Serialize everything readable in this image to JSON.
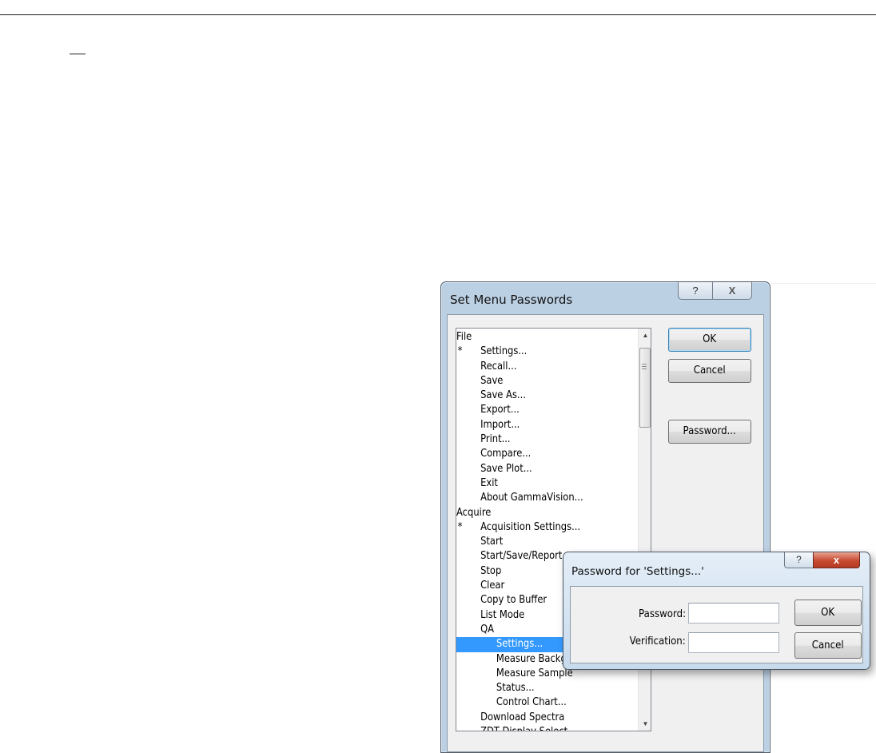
{
  "dialog": {
    "title": "Set Menu Passwords",
    "help_glyph": "?",
    "close_glyph": "X",
    "ok_label": "OK",
    "cancel_label": "Cancel",
    "password_button_label": "Password...",
    "menu_items": [
      {
        "label": "File",
        "level": 0,
        "star": ""
      },
      {
        "label": "Settings...",
        "level": 1,
        "star": "*"
      },
      {
        "label": "Recall...",
        "level": 1,
        "star": ""
      },
      {
        "label": "Save",
        "level": 1,
        "star": ""
      },
      {
        "label": "Save As...",
        "level": 1,
        "star": ""
      },
      {
        "label": "Export...",
        "level": 1,
        "star": ""
      },
      {
        "label": "Import...",
        "level": 1,
        "star": ""
      },
      {
        "label": "Print...",
        "level": 1,
        "star": ""
      },
      {
        "label": "Compare...",
        "level": 1,
        "star": ""
      },
      {
        "label": "Save Plot...",
        "level": 1,
        "star": ""
      },
      {
        "label": "Exit",
        "level": 1,
        "star": ""
      },
      {
        "label": "About GammaVision...",
        "level": 1,
        "star": ""
      },
      {
        "label": "Acquire",
        "level": 0,
        "star": ""
      },
      {
        "label": "Acquisition Settings...",
        "level": 1,
        "star": "*"
      },
      {
        "label": "Start",
        "level": 1,
        "star": ""
      },
      {
        "label": "Start/Save/Report",
        "level": 1,
        "star": ""
      },
      {
        "label": "Stop",
        "level": 1,
        "star": ""
      },
      {
        "label": "Clear",
        "level": 1,
        "star": ""
      },
      {
        "label": "Copy to Buffer",
        "level": 1,
        "star": ""
      },
      {
        "label": "List Mode",
        "level": 1,
        "star": ""
      },
      {
        "label": "QA",
        "level": 1,
        "star": ""
      },
      {
        "label": "Settings...",
        "level": 2,
        "star": "",
        "selected": true
      },
      {
        "label": "Measure Background",
        "level": 2,
        "star": ""
      },
      {
        "label": "Measure Sample",
        "level": 2,
        "star": ""
      },
      {
        "label": "Status...",
        "level": 2,
        "star": ""
      },
      {
        "label": "Control Chart...",
        "level": 2,
        "star": ""
      },
      {
        "label": "Download Spectra",
        "level": 1,
        "star": ""
      },
      {
        "label": "ZDT Display Select",
        "level": 1,
        "star": ""
      }
    ],
    "scroll_position": 0.12
  },
  "password_dialog": {
    "title": "Password for 'Settings...'",
    "help_glyph": "?",
    "close_glyph": "x",
    "password_label": "Password:",
    "verification_label": "Verification:",
    "password_value": "",
    "verification_value": "",
    "ok_label": "OK",
    "cancel_label": "Cancel"
  }
}
